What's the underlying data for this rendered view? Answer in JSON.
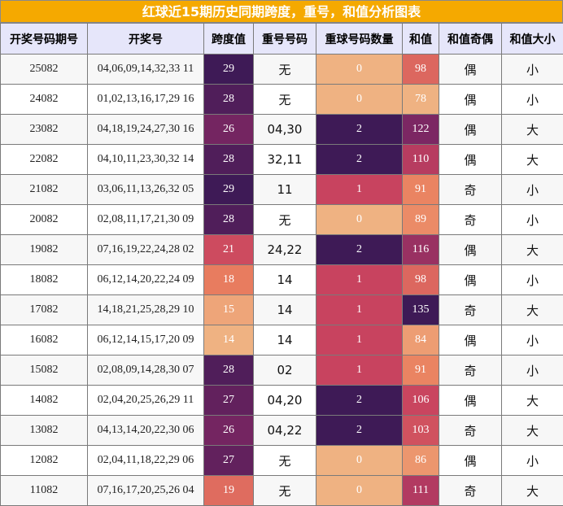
{
  "title": "红球近15期历史同期跨度，重号，和值分析图表",
  "chart_data": {
    "type": "table",
    "columns": [
      "开奖号码期号",
      "开奖号",
      "跨度值",
      "重号号码",
      "重球号码数量",
      "和值",
      "和值奇偶",
      "和值大小"
    ],
    "rows": [
      {
        "period": "25082",
        "numbers": "04,06,09,14,32,33 11",
        "span": 29,
        "repeat": "无",
        "repeat_count": 0,
        "sum": 98,
        "parity": "偶",
        "size": "小"
      },
      {
        "period": "24082",
        "numbers": "01,02,13,16,17,29 16",
        "span": 28,
        "repeat": "无",
        "repeat_count": 0,
        "sum": 78,
        "parity": "偶",
        "size": "小"
      },
      {
        "period": "23082",
        "numbers": "04,18,19,24,27,30 16",
        "span": 26,
        "repeat": "04,30",
        "repeat_count": 2,
        "sum": 122,
        "parity": "偶",
        "size": "大"
      },
      {
        "period": "22082",
        "numbers": "04,10,11,23,30,32 14",
        "span": 28,
        "repeat": "32,11",
        "repeat_count": 2,
        "sum": 110,
        "parity": "偶",
        "size": "大"
      },
      {
        "period": "21082",
        "numbers": "03,06,11,13,26,32 05",
        "span": 29,
        "repeat": "11",
        "repeat_count": 1,
        "sum": 91,
        "parity": "奇",
        "size": "小"
      },
      {
        "period": "20082",
        "numbers": "02,08,11,17,21,30 09",
        "span": 28,
        "repeat": "无",
        "repeat_count": 0,
        "sum": 89,
        "parity": "奇",
        "size": "小"
      },
      {
        "period": "19082",
        "numbers": "07,16,19,22,24,28 02",
        "span": 21,
        "repeat": "24,22",
        "repeat_count": 2,
        "sum": 116,
        "parity": "偶",
        "size": "大"
      },
      {
        "period": "18082",
        "numbers": "06,12,14,20,22,24 09",
        "span": 18,
        "repeat": "14",
        "repeat_count": 1,
        "sum": 98,
        "parity": "偶",
        "size": "小"
      },
      {
        "period": "17082",
        "numbers": "14,18,21,25,28,29 10",
        "span": 15,
        "repeat": "14",
        "repeat_count": 1,
        "sum": 135,
        "parity": "奇",
        "size": "大"
      },
      {
        "period": "16082",
        "numbers": "06,12,14,15,17,20 09",
        "span": 14,
        "repeat": "14",
        "repeat_count": 1,
        "sum": 84,
        "parity": "偶",
        "size": "小"
      },
      {
        "period": "15082",
        "numbers": "02,08,09,14,28,30 07",
        "span": 28,
        "repeat": "02",
        "repeat_count": 1,
        "sum": 91,
        "parity": "奇",
        "size": "小"
      },
      {
        "period": "14082",
        "numbers": "02,04,20,25,26,29 11",
        "span": 27,
        "repeat": "04,20",
        "repeat_count": 2,
        "sum": 106,
        "parity": "偶",
        "size": "大"
      },
      {
        "period": "13082",
        "numbers": "04,13,14,20,22,30 06",
        "span": 26,
        "repeat": "04,22",
        "repeat_count": 2,
        "sum": 103,
        "parity": "奇",
        "size": "大"
      },
      {
        "period": "12082",
        "numbers": "02,04,11,18,22,29 06",
        "span": 27,
        "repeat": "无",
        "repeat_count": 0,
        "sum": 86,
        "parity": "偶",
        "size": "小"
      },
      {
        "period": "11082",
        "numbers": "07,16,17,20,25,26 04",
        "span": 19,
        "repeat": "无",
        "repeat_count": 0,
        "sum": 111,
        "parity": "奇",
        "size": "大"
      }
    ],
    "colors": {
      "title_bg": "#f5a900",
      "header_bg": "#e6e6fa",
      "heat_low": "#efb183",
      "heat_mid": "#c8435f",
      "heat_high": "#3e1a56"
    }
  }
}
